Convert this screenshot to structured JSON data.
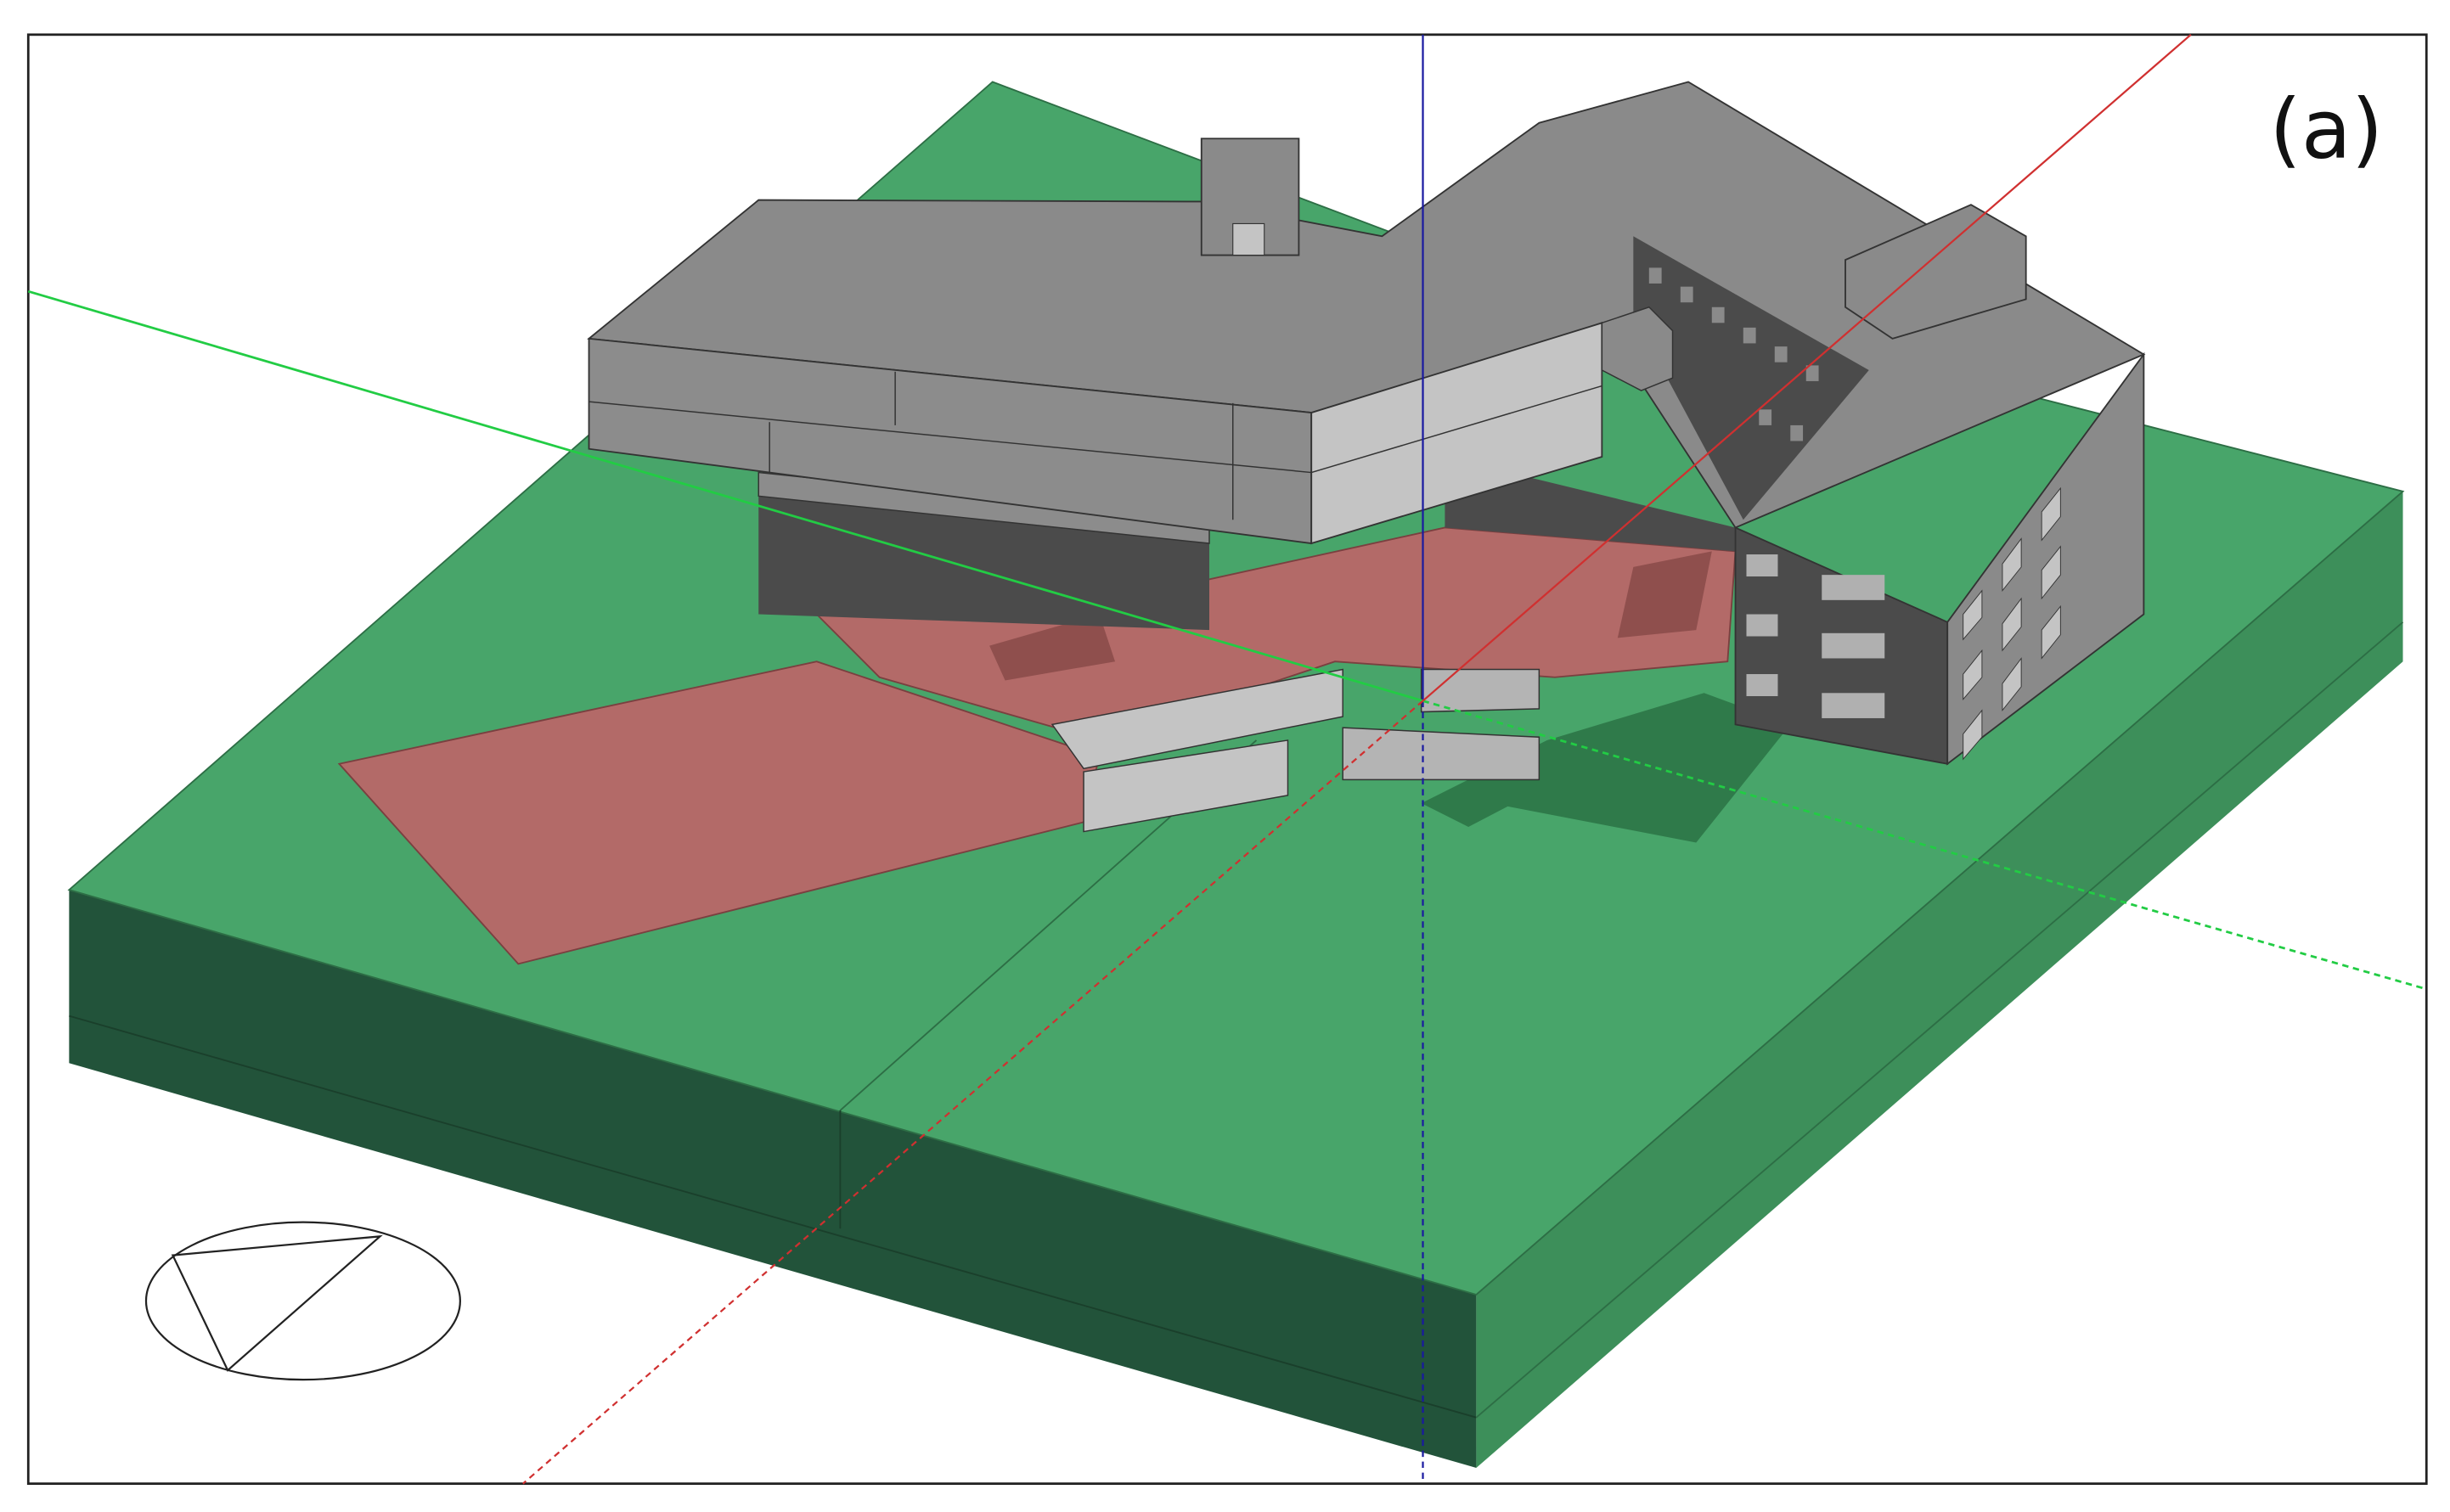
{
  "figure": {
    "panel_label": "(a)",
    "colors": {
      "ground_top": "#48a56a",
      "ground_left": "#22533a",
      "ground_right": "#3d8f5a",
      "roof": "#8a8a8a",
      "wall_light": "#c4c4c4",
      "wall_dark": "#4b4b4b",
      "plaza": "#b36a68",
      "axis_x": "#d03030",
      "axis_y": "#22cc44",
      "axis_z": "#1a1aa0"
    }
  }
}
